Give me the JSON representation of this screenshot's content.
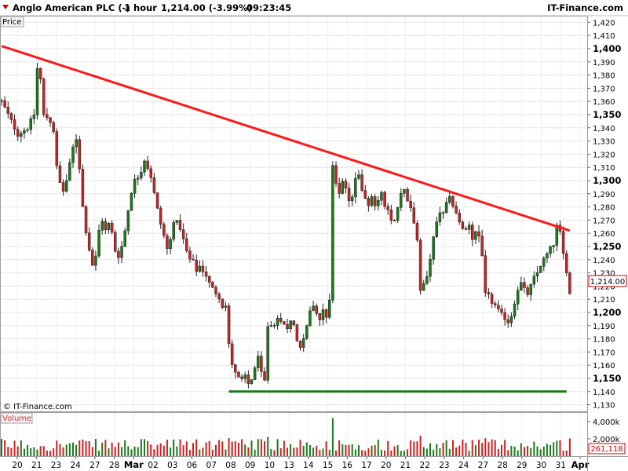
{
  "header": {
    "instrument": "Anglo American PLC (-)",
    "interval": "1 hour",
    "last_change": "1,214.00 (-3.99%)",
    "time": "09:23:45",
    "brand": "IT-Finance.com"
  },
  "panels": {
    "price_label": "Price",
    "volume_label": "Volume",
    "watermark": "© IT-Finance.com",
    "last_price_tag": "1,214.00",
    "last_volume_tag": "261,118"
  },
  "colors": {
    "up": "#1b7a1b",
    "down": "#cc2222",
    "resistance": "#ff1a1a",
    "support": "#1a7a1a",
    "grid": "#e6e6e6"
  },
  "chart_data": {
    "type": "candlestick",
    "title": "Anglo American PLC (-)",
    "price_axis": {
      "ticks": [
        "1,420",
        "1,410",
        "1,400",
        "1,390",
        "1,380",
        "1,370",
        "1,360",
        "1,350",
        "1,340",
        "1,330",
        "1,320",
        "1,310",
        "1,300",
        "1,290",
        "1,280",
        "1,270",
        "1,260",
        "1,250",
        "1,240",
        "1,230",
        "1,220",
        "1,210",
        "1,200",
        "1,190",
        "1,180",
        "1,170",
        "1,160",
        "1,150",
        "1,140",
        "1,130"
      ],
      "bold_ticks": [
        "1,400",
        "1,350",
        "1,300",
        "1,250",
        "1,200",
        "1,150"
      ],
      "range": [
        1125,
        1425
      ]
    },
    "volume_axis": {
      "ticks": [
        "4,000k",
        "2,000k"
      ],
      "range": [
        0,
        5000
      ]
    },
    "x_labels": [
      "20",
      "21",
      "23",
      "24",
      "27",
      "28",
      "Mar",
      "02",
      "03",
      "06",
      "07",
      "08",
      "09",
      "10",
      "13",
      "14",
      "15",
      "16",
      "17",
      "20",
      "21",
      "22",
      "23",
      "24",
      "27",
      "28",
      "29",
      "30",
      "31",
      "Apr"
    ],
    "path": [
      [
        0,
        1360
      ],
      [
        3,
        1345
      ],
      [
        5,
        1335
      ],
      [
        8,
        1340
      ],
      [
        10,
        1350
      ],
      [
        11,
        1385
      ],
      [
        11.6,
        1398
      ],
      [
        12.5,
        1350
      ],
      [
        14,
        1348
      ],
      [
        15,
        1345
      ],
      [
        16,
        1338
      ],
      [
        17,
        1310
      ],
      [
        18,
        1298
      ],
      [
        19,
        1292
      ],
      [
        20,
        1300
      ],
      [
        21,
        1312
      ],
      [
        22,
        1325
      ],
      [
        23,
        1332
      ],
      [
        24,
        1310
      ],
      [
        25,
        1280
      ],
      [
        26,
        1262
      ],
      [
        27,
        1248
      ],
      [
        28,
        1236
      ],
      [
        29,
        1242
      ],
      [
        30,
        1262
      ],
      [
        31,
        1270
      ],
      [
        32,
        1262
      ],
      [
        33,
        1267
      ],
      [
        34,
        1260
      ],
      [
        35,
        1247
      ],
      [
        36,
        1243
      ],
      [
        37,
        1250
      ],
      [
        38,
        1262
      ],
      [
        39,
        1278
      ],
      [
        40,
        1292
      ],
      [
        41,
        1300
      ],
      [
        42,
        1303
      ],
      [
        43,
        1308
      ],
      [
        44,
        1316
      ],
      [
        45,
        1310
      ],
      [
        46,
        1303
      ],
      [
        47,
        1290
      ],
      [
        48,
        1278
      ],
      [
        49,
        1267
      ],
      [
        50,
        1258
      ],
      [
        51,
        1248
      ],
      [
        52,
        1255
      ],
      [
        53,
        1270
      ],
      [
        54,
        1268
      ],
      [
        55,
        1264
      ],
      [
        56,
        1255
      ],
      [
        57,
        1246
      ],
      [
        58,
        1240
      ],
      [
        59,
        1238
      ],
      [
        60,
        1232
      ],
      [
        61,
        1235
      ],
      [
        62,
        1232
      ],
      [
        63,
        1228
      ],
      [
        64,
        1222
      ],
      [
        65,
        1218
      ],
      [
        66,
        1215
      ],
      [
        67,
        1212
      ],
      [
        68,
        1205
      ],
      [
        69,
        1205
      ],
      [
        70,
        1175
      ],
      [
        71,
        1162
      ],
      [
        72,
        1155
      ],
      [
        73,
        1150
      ],
      [
        74,
        1148
      ],
      [
        75,
        1152
      ],
      [
        76,
        1146
      ],
      [
        77,
        1150
      ],
      [
        78,
        1158
      ],
      [
        79,
        1165
      ],
      [
        80,
        1154
      ],
      [
        81,
        1148
      ],
      [
        82,
        1190
      ],
      [
        83,
        1192
      ],
      [
        84,
        1188
      ],
      [
        85,
        1194
      ],
      [
        86,
        1192
      ],
      [
        87,
        1190
      ],
      [
        88,
        1188
      ],
      [
        89,
        1195
      ],
      [
        90,
        1190
      ],
      [
        91,
        1180
      ],
      [
        92,
        1172
      ],
      [
        93,
        1182
      ],
      [
        94,
        1192
      ],
      [
        95,
        1200
      ],
      [
        96,
        1206
      ],
      [
        97,
        1200
      ],
      [
        98,
        1196
      ],
      [
        99,
        1202
      ],
      [
        100,
        1198
      ],
      [
        101,
        1210
      ],
      [
        102,
        1312
      ],
      [
        103,
        1298
      ],
      [
        104,
        1290
      ],
      [
        105,
        1300
      ],
      [
        106,
        1295
      ],
      [
        107,
        1285
      ],
      [
        108,
        1288
      ],
      [
        109,
        1300
      ],
      [
        110,
        1304
      ],
      [
        111,
        1294
      ],
      [
        112,
        1288
      ],
      [
        113,
        1280
      ],
      [
        114,
        1286
      ],
      [
        115,
        1282
      ],
      [
        116,
        1284
      ],
      [
        117,
        1290
      ],
      [
        118,
        1280
      ],
      [
        119,
        1276
      ],
      [
        120,
        1270
      ],
      [
        121,
        1268
      ],
      [
        122,
        1280
      ],
      [
        123,
        1290
      ],
      [
        124,
        1292
      ],
      [
        125,
        1285
      ],
      [
        126,
        1280
      ],
      [
        127,
        1268
      ],
      [
        128,
        1255
      ],
      [
        129,
        1215
      ],
      [
        130,
        1222
      ],
      [
        131,
        1228
      ],
      [
        132,
        1240
      ],
      [
        133,
        1256
      ],
      [
        134,
        1268
      ],
      [
        135,
        1276
      ],
      [
        136,
        1274
      ],
      [
        137,
        1282
      ],
      [
        138,
        1286
      ],
      [
        139,
        1282
      ],
      [
        140,
        1276
      ],
      [
        141,
        1268
      ],
      [
        142,
        1264
      ],
      [
        143,
        1262
      ],
      [
        144,
        1265
      ],
      [
        145,
        1256
      ],
      [
        146,
        1260
      ],
      [
        147,
        1258
      ],
      [
        148,
        1245
      ],
      [
        149,
        1214
      ],
      [
        150,
        1212
      ],
      [
        151,
        1208
      ],
      [
        152,
        1205
      ],
      [
        153,
        1201
      ],
      [
        154,
        1198
      ],
      [
        155,
        1196
      ],
      [
        156,
        1193
      ],
      [
        157,
        1198
      ],
      [
        158,
        1208
      ],
      [
        159,
        1218
      ],
      [
        160,
        1222
      ],
      [
        161,
        1217
      ],
      [
        162,
        1214
      ],
      [
        163,
        1220
      ],
      [
        164,
        1226
      ],
      [
        165,
        1230
      ],
      [
        166,
        1236
      ],
      [
        167,
        1240
      ],
      [
        168,
        1244
      ],
      [
        169,
        1248
      ],
      [
        170,
        1252
      ],
      [
        171,
        1265
      ],
      [
        172,
        1260
      ],
      [
        173,
        1244
      ],
      [
        174,
        1232
      ],
      [
        175,
        1214
      ]
    ],
    "resistance_line": {
      "from": [
        0,
        1402
      ],
      "to": [
        175,
        1262
      ]
    },
    "support_line": {
      "from": [
        70,
        1140
      ],
      "to": [
        174,
        1140
      ]
    },
    "volume_spike": {
      "bar": 102,
      "value": 4400
    }
  }
}
